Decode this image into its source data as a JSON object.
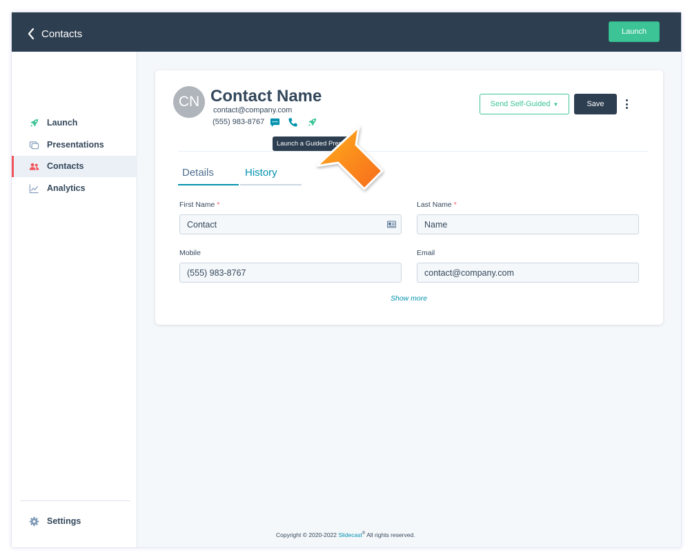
{
  "topbar": {
    "back_label": "Contacts",
    "launch_label": "Launch"
  },
  "sidebar": {
    "items": [
      {
        "label": "Launch",
        "icon": "rocket-icon"
      },
      {
        "label": "Presentations",
        "icon": "slides-icon"
      },
      {
        "label": "Contacts",
        "icon": "people-icon",
        "active": true
      },
      {
        "label": "Analytics",
        "icon": "chart-icon"
      }
    ],
    "settings_label": "Settings"
  },
  "contact": {
    "initials": "CN",
    "name": "Contact Name",
    "email": "contact@company.com",
    "phone": "(555) 983-8767",
    "tooltip": "Launch a Guided Presentation"
  },
  "actions": {
    "send_label": "Send Self-Guided",
    "save_label": "Save"
  },
  "tabs": [
    {
      "label": "Details",
      "active": true
    },
    {
      "label": "History"
    }
  ],
  "form": {
    "first_name": {
      "label": "First Name",
      "required": "*",
      "value": "Contact"
    },
    "last_name": {
      "label": "Last Name",
      "required": "*",
      "value": "Name"
    },
    "mobile": {
      "label": "Mobile",
      "value": "(555) 983-8767"
    },
    "email": {
      "label": "Email",
      "value": "contact@company.com"
    },
    "show_more": "Show more"
  },
  "footer": {
    "prefix": "Copyright © 2020-2022 ",
    "brand": "Slidecast",
    "reg": "®",
    "suffix": " All rights reserved."
  },
  "colors": {
    "topbar": "#2d3e50",
    "accent_green": "#3cc496",
    "link_blue": "#0091ae",
    "active_red": "#f2545b",
    "arrow_orange": "#f7931e"
  }
}
